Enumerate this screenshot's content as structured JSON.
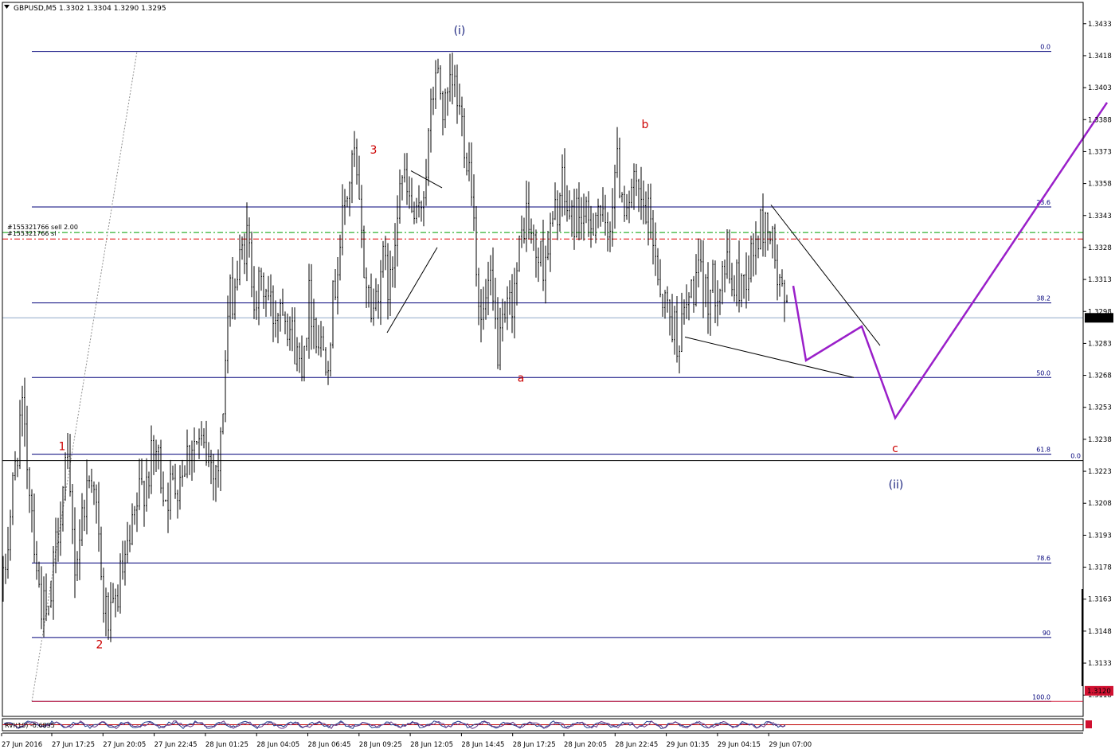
{
  "header": {
    "title": "GBPUSD,M5  1.3302 1.3304 1.3290 1.3295"
  },
  "chart_data": {
    "type": "candlestick",
    "symbol": "GBPUSD",
    "timeframe": "M5",
    "ohlc_header": {
      "open": 1.3302,
      "high": 1.3304,
      "low": 1.329,
      "close": 1.3295
    },
    "ylim": [
      1.3108,
      1.3443
    ],
    "y_ticks": [
      "1.3433",
      "1.3418",
      "1.3403",
      "1.3388",
      "1.3373",
      "1.3358",
      "1.3343",
      "1.3328",
      "1.3313",
      "1.3298",
      "1.3283",
      "1.3268",
      "1.3253",
      "1.3238",
      "1.3223",
      "1.3208",
      "1.3193",
      "1.3178",
      "1.3163",
      "1.3148",
      "1.3133",
      "1.3118"
    ],
    "x_ticks": [
      "27 Jun 2016",
      "27 Jun 17:25",
      "27 Jun 20:05",
      "27 Jun 22:45",
      "28 Jun 01:25",
      "28 Jun 04:05",
      "28 Jun 06:45",
      "28 Jun 09:25",
      "28 Jun 12:05",
      "28 Jun 14:45",
      "28 Jun 17:25",
      "28 Jun 20:05",
      "28 Jun 22:45",
      "29 Jun 01:35",
      "29 Jun 04:15",
      "29 Jun 07:00"
    ],
    "price_path": [
      1.3168,
      1.3212,
      1.3252,
      1.3215,
      1.3166,
      1.315,
      1.3195,
      1.3228,
      1.3178,
      1.321,
      1.3226,
      1.3162,
      1.315,
      1.3172,
      1.3185,
      1.321,
      1.3222,
      1.3232,
      1.3212,
      1.3216,
      1.3227,
      1.3238,
      1.3233,
      1.3228,
      1.3225,
      1.33,
      1.3315,
      1.3333,
      1.3305,
      1.331,
      1.3296,
      1.3306,
      1.3288,
      1.3272,
      1.3305,
      1.3285,
      1.3278,
      1.3318,
      1.335,
      1.337,
      1.332,
      1.3296,
      1.3322,
      1.3308,
      1.3365,
      1.335,
      1.3336,
      1.3368,
      1.3412,
      1.339,
      1.3405,
      1.3385,
      1.336,
      1.329,
      1.331,
      1.3278,
      1.3296,
      1.3315,
      1.3346,
      1.3325,
      1.3322,
      1.3338,
      1.3356,
      1.334,
      1.3346,
      1.3336,
      1.335,
      1.3328,
      1.3368,
      1.335,
      1.3354,
      1.3345,
      1.3338,
      1.3308,
      1.3296,
      1.3285,
      1.3302,
      1.3314,
      1.3306,
      1.331,
      1.332,
      1.331,
      1.3312,
      1.3322,
      1.3336,
      1.334,
      1.3312,
      1.3295
    ],
    "candle_noise": 0.0022,
    "fibonacci": [
      {
        "level": "0.0",
        "price": 1.342
      },
      {
        "level": "23.6",
        "price": 1.3347
      },
      {
        "level": "38.2",
        "price": 1.3302
      },
      {
        "level": "50.0",
        "price": 1.3267
      },
      {
        "level": "61.8",
        "price": 1.3231
      },
      {
        "level": "78.6",
        "price": 1.318
      },
      {
        "level": "90",
        "price": 1.3145
      },
      {
        "level": "100.0",
        "price": 1.3115
      }
    ],
    "price_labels": {
      "current": "1.3295",
      "low": "1.3120"
    },
    "orders": [
      {
        "label": "#155321766 sell 2.00",
        "price": 1.3335,
        "color": "#00a000"
      },
      {
        "label": "#155321766 sl",
        "price": 1.3332,
        "color": "#e00000"
      }
    ],
    "black_level": {
      "label": "0.0",
      "price": 1.3228
    },
    "wave_labels": [
      {
        "text": "(i)",
        "x": 1.3428,
        "pos": 577,
        "color": "#1a237e"
      },
      {
        "text": "3",
        "x": 1.3372,
        "pos": 469,
        "color": "#cc0000"
      },
      {
        "text": "b",
        "x": 1.3384,
        "pos": 810,
        "color": "#cc0000"
      },
      {
        "text": "a",
        "x": 1.3265,
        "pos": 654,
        "color": "#cc0000"
      },
      {
        "text": "1",
        "x": 1.3233,
        "pos": 78,
        "color": "#cc0000"
      },
      {
        "text": "2",
        "x": 1.314,
        "pos": 125,
        "color": "#cc0000"
      },
      {
        "text": "c",
        "x": 1.3232,
        "pos": 1124,
        "color": "#cc0000"
      },
      {
        "text": "(ii)",
        "x": 1.3215,
        "pos": 1125,
        "color": "#1a237e"
      }
    ],
    "projection": [
      [
        1.331,
        996
      ],
      [
        1.3275,
        1012
      ],
      [
        1.3291,
        1082
      ],
      [
        1.3248,
        1124
      ],
      [
        1.3396,
        1390
      ]
    ],
    "trendlines": [
      {
        "points": [
          [
            1.3288,
            486
          ],
          [
            1.3328,
            549
          ]
        ]
      },
      {
        "points": [
          [
            1.3364,
            516
          ],
          [
            1.3356,
            555
          ]
        ]
      },
      {
        "points": [
          [
            1.3286,
            860
          ],
          [
            1.3267,
            1072
          ]
        ]
      },
      {
        "points": [
          [
            1.3348,
            968
          ],
          [
            1.3282,
            1105
          ]
        ]
      }
    ],
    "oscillator": {
      "label": "RVI(10) -0.6835"
    }
  }
}
